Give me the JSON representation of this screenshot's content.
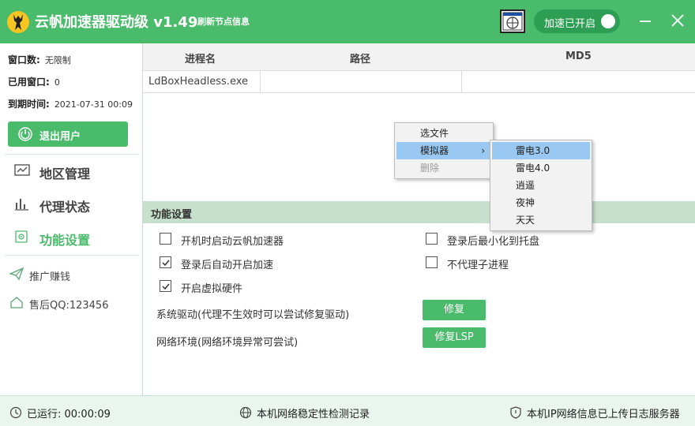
{
  "titlebar": {
    "title": "云帆加速器驱动级 v1.49",
    "refresh_label": "刷新节点信息",
    "accel_toggle_label": "加速已开启"
  },
  "sidebar": {
    "info": [
      {
        "label": "窗口数:",
        "value": "无限制"
      },
      {
        "label": "已用窗口:",
        "value": "0"
      },
      {
        "label": "到期时间:",
        "value": "2021-07-31 00:09"
      }
    ],
    "logout_label": "退出用户",
    "nav": [
      {
        "label": "地区管理",
        "icon": "monitor-chart-icon"
      },
      {
        "label": "代理状态",
        "icon": "bar-chart-icon"
      },
      {
        "label": "功能设置",
        "icon": "settings-icon",
        "active": true
      }
    ],
    "links": [
      {
        "label": "推广赚钱",
        "icon": "paper-plane-icon"
      },
      {
        "label": "售后QQ:123456",
        "icon": "home-icon"
      }
    ]
  },
  "table": {
    "headers": [
      "进程名",
      "路径",
      "MD5"
    ],
    "rows": [
      {
        "name": "LdBoxHeadless.exe",
        "path": "",
        "md5": ""
      }
    ]
  },
  "context_menu": {
    "items": [
      "选文件",
      "模拟器",
      "删除"
    ],
    "submenu": [
      "雷电3.0",
      "雷电4.0",
      "逍遥",
      "夜神",
      "天天"
    ]
  },
  "settings": {
    "header": "功能设置",
    "options": [
      {
        "label": "开机时启动云帆加速器",
        "checked": false
      },
      {
        "label": "登录后自动开启加速",
        "checked": true
      },
      {
        "label": "开启虚拟硬件",
        "checked": true
      },
      {
        "label": "登录后最小化到托盘",
        "checked": false
      },
      {
        "label": "不代理子进程",
        "checked": false
      }
    ],
    "driver_text": "系统驱动(代理不生效时可以尝试修复驱动)",
    "driver_button": "修复",
    "network_text": "网络环境(网络环境异常可尝试)",
    "network_button": "修复LSP"
  },
  "statusbar": {
    "runtime": "已运行:   00:00:09",
    "network_check": "本机网络稳定性检测记录",
    "upload_log": "本机IP网络信息已上传日志服务器"
  },
  "colors": {
    "accent": "#4aba6b",
    "menu_highlight": "#99c9f3"
  }
}
